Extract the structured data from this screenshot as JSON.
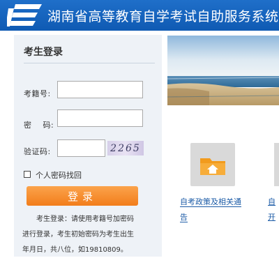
{
  "header": {
    "title": "湖南省高等教育自学考试自助服务系统",
    "logo_icon": "exam-logo-icon",
    "brand_color": "#1565c0"
  },
  "login": {
    "title": "考生登录",
    "exam_no_label": "考籍号:",
    "exam_no_value": "",
    "password_label": "密    码:",
    "password_value": "",
    "captcha_label": "验证码:",
    "captcha_value": "",
    "captcha_text": "2265",
    "recover_label": "个人密码找回",
    "login_button": "登录",
    "note_line1": "考生登录：请使用考籍号加密码",
    "note_line2": "进行登录，考生初始密码为考生出生",
    "note_line3": "年月日，共八位，如19810809。",
    "accent_color": "#f5871f"
  },
  "tiles": [
    {
      "icon": "home-folder-icon",
      "label_line1": "自考政策及相关通",
      "label_line2": "告"
    },
    {
      "icon": "folder-icon",
      "label_line1": "自",
      "label_line2": "开"
    }
  ]
}
